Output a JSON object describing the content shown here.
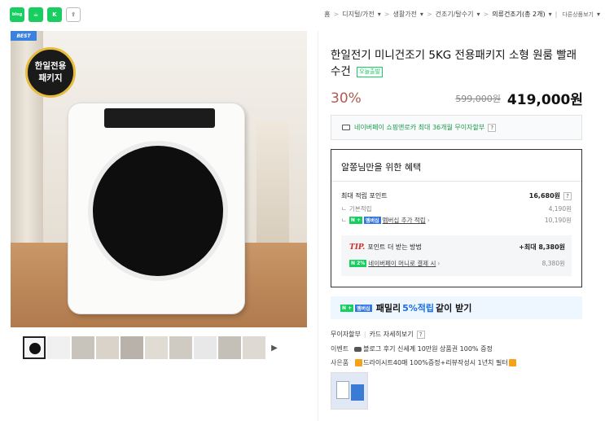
{
  "share": {
    "blog": "blog",
    "cafe": "☕",
    "talk": "K",
    "share": "⇪"
  },
  "breadcrumb": {
    "items": [
      "홈",
      "디지털/가전",
      "생활가전",
      "건조기/탈수기"
    ],
    "current": "의류건조기(총 2개)",
    "others": "다른상품보기"
  },
  "image": {
    "best": "BEST",
    "badge_line1": "한일전용",
    "badge_line2": "패키지"
  },
  "product": {
    "title": "한일전기 미니건조기 5KG 전용패키지 소형 원룸 빨래 수건",
    "today_tag": "오늘출발",
    "discount": "30%",
    "original_price": "599,000원",
    "final_price": "419,000원"
  },
  "npay": {
    "text": "네이버페이 쇼핑앤로카 최대 36개월 무이자할부",
    "q": "?"
  },
  "benefit": {
    "title": "알쫑님만을 위한 혜택",
    "max_points_label": "최대 적립 포인트",
    "max_points_value": "16,680원",
    "basic_label": "기본적립",
    "basic_value": "4,190원",
    "member_badge": "N +",
    "member_badge2": "멤버십",
    "member_label": "멤버십 추가 적립",
    "member_value": "10,190원",
    "tip_label": "TIP.",
    "tip_text": "포인트 더 받는 방법",
    "tip_value": "+최대 8,380원",
    "money_badge": "N 2%",
    "money_label": "네이버페이 머니로 결제 시",
    "money_value": "8,380원"
  },
  "family": {
    "badge": "N +",
    "badge2": "멤버십",
    "prefix": "패밀리",
    "highlight": "5%적립",
    "suffix": "같이 받기"
  },
  "info": {
    "installment": "무이자할부",
    "card_detail": "카드 자세히보기",
    "event_label": "이벤트",
    "event_text": "블로그 후기 신세계 10만원 상품권 100% 증정",
    "gift_label": "사은품",
    "gift_text": "드라이시트40매 100%증정+리뷰작성시 1년치 필터"
  }
}
